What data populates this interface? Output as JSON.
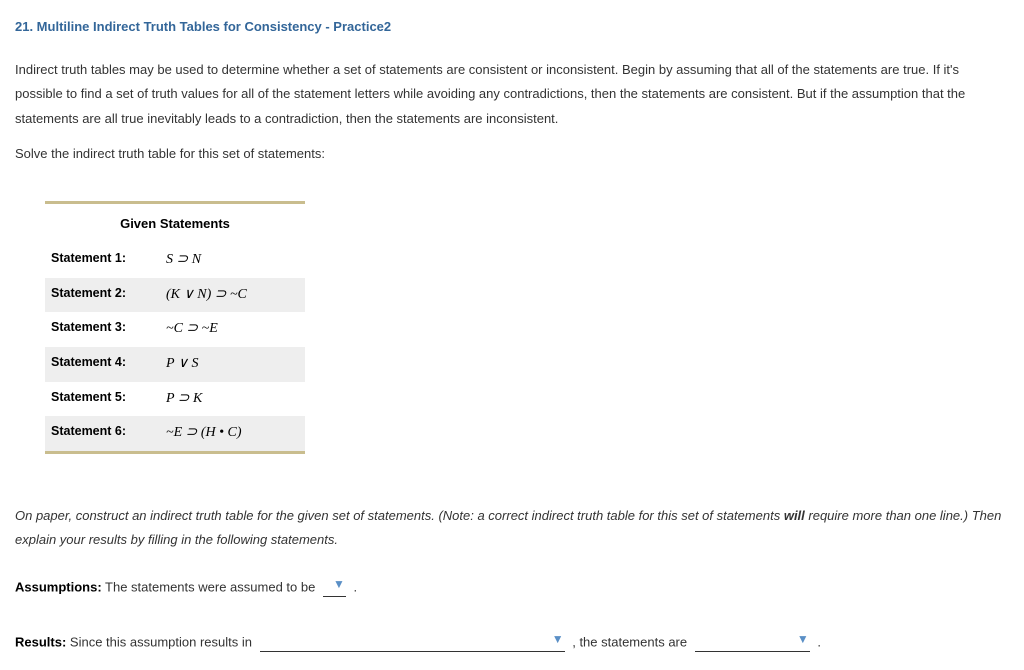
{
  "title": "21. Multiline Indirect Truth Tables for Consistency - Practice2",
  "intro": "Indirect truth tables may be used to determine whether a set of statements are consistent or inconsistent. Begin by assuming that all of the statements are true. If it's possible to find a set of truth values for all of the statement letters while avoiding any contradictions, then the statements are consistent. But if the assumption that the statements are all true inevitably leads to a contradiction, then the statements are inconsistent.",
  "instruction": "Solve the indirect truth table for this set of statements:",
  "statements": {
    "header": "Given Statements",
    "rows": [
      {
        "label": "Statement 1:",
        "expr": "S ⊃ N"
      },
      {
        "label": "Statement 2:",
        "expr": "(K ∨ N) ⊃ ~C"
      },
      {
        "label": "Statement 3:",
        "expr": "~C ⊃ ~E"
      },
      {
        "label": "Statement 4:",
        "expr": "P ∨ S"
      },
      {
        "label": "Statement 5:",
        "expr": "P ⊃ K"
      },
      {
        "label": "Statement 6:",
        "expr": "~E ⊃ (H • C)"
      }
    ]
  },
  "note_pre": "On paper, construct an indirect truth table for the given set of statements. (Note: a correct indirect truth table for this set of statements ",
  "note_bold": "will",
  "note_post": " require more than one line.) Then explain your results by filling in the following statements.",
  "assumptions": {
    "label": "Assumptions:",
    "text": " The statements were assumed to be ",
    "dropdown_value": "",
    "after": " ."
  },
  "results": {
    "label": "Results:",
    "text_a": " Since this assumption results in ",
    "dropdown1_value": "",
    "text_b": " , the statements are ",
    "dropdown2_value": "",
    "after": " ."
  }
}
